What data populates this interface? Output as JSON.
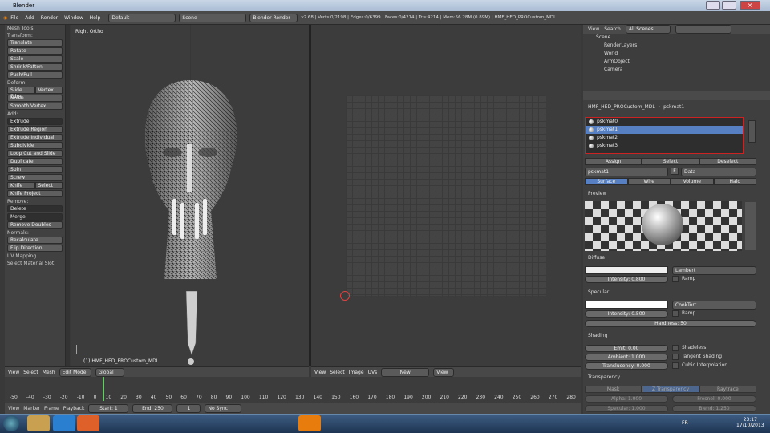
{
  "window": {
    "title": "Blender"
  },
  "topbar": {
    "menus": [
      "File",
      "Add",
      "Render",
      "Window",
      "Help"
    ],
    "layout": "Default",
    "scene": "Scene",
    "engine": "Blender Render",
    "stats": "v2.68 | Verts:0/2198 | Edges:0/6399 | Faces:0/4214 | Tris:4214 | Mem:56.28M (0.89M) | HMF_HED_PROCustom_MDL"
  },
  "toolshelf": {
    "header": "Mesh Tools",
    "transform_label": "Transform:",
    "transform": [
      "Translate",
      "Rotate",
      "Scale",
      "Shrink/Fatten",
      "Push/Pull"
    ],
    "deform_label": "Deform:",
    "slide_edge": "Slide Edge",
    "vertex": "Vertex",
    "deform": [
      "Noise",
      "Smooth Vertex"
    ],
    "add_label": "Add:",
    "extrude": "Extrude",
    "add": [
      "Extrude Region",
      "Extrude Individual",
      "Subdivide",
      "Loop Cut and Slide",
      "Duplicate",
      "Spin",
      "Screw"
    ],
    "knife": "Knife",
    "select": "Select",
    "knife_project": "Knife Project",
    "remove_label": "Remove:",
    "delete": "Delete",
    "merge": "Merge",
    "remove_doubles": "Remove Doubles",
    "normals_label": "Normals:",
    "normals": [
      "Recalculate",
      "Flip Direction"
    ],
    "uv_mapping": "UV Mapping",
    "select_slot": "Select Material Slot"
  },
  "viewport": {
    "view_label": "Right Ortho",
    "object_label": "(1) HMF_HED_PROCustom_MDL"
  },
  "view3d_header": {
    "menus": [
      "View",
      "Select",
      "Mesh"
    ],
    "mode": "Edit Mode",
    "orientation": "Global"
  },
  "image_header": {
    "menus": [
      "View",
      "Select",
      "Image",
      "UVs"
    ],
    "new_btn": "New",
    "view": "View"
  },
  "timeline": {
    "ticks": [
      "-50",
      "-40",
      "-30",
      "-20",
      "-10",
      "0",
      "10",
      "20",
      "30",
      "40",
      "50",
      "60",
      "70",
      "80",
      "90",
      "100",
      "110",
      "120",
      "130",
      "140",
      "150",
      "160",
      "170",
      "180",
      "190",
      "200",
      "210",
      "220",
      "230",
      "240",
      "250",
      "260",
      "270",
      "280"
    ]
  },
  "timeline_header": {
    "menus": [
      "View",
      "Marker",
      "Frame",
      "Playback"
    ],
    "start": "Start: 1",
    "end": "End: 250",
    "current": "1",
    "sync": "No Sync"
  },
  "outliner": {
    "menus": [
      "View",
      "Search"
    ],
    "filter": "All Scenes",
    "items": [
      "Scene",
      "RenderLayers",
      "World",
      "ArmObject",
      "Camera"
    ]
  },
  "properties": {
    "breadcrumb_obj": "HMF_HED_PROCustom_MDL",
    "breadcrumb_mat": "pskmat1",
    "slots": [
      "pskmat0",
      "pskmat1",
      "pskmat2",
      "pskmat3"
    ],
    "assign": "Assign",
    "select": "Select",
    "deselect": "Deselect",
    "material_name": "pskmat1",
    "f": "F",
    "data": "Data",
    "tabs": [
      "Surface",
      "Wire",
      "Volume",
      "Halo"
    ],
    "preview": "Preview",
    "diffuse": "Diffuse",
    "diffuse_shader": "Lambert",
    "intensity_d": "Intensity: 0.800",
    "ramp": "Ramp",
    "specular": "Specular",
    "specular_shader": "CookTorr",
    "intensity_s": "Intensity: 0.500",
    "hardness": "Hardness: 50",
    "shading": "Shading",
    "emit": "Emit: 0.00",
    "ambient": "Ambient: 1.000",
    "translucency": "Translucency: 0.000",
    "shadeless": "Shadeless",
    "tangent": "Tangent Shading",
    "cubic": "Cubic Interpolation",
    "transparency": "Transparency",
    "mask": "Mask",
    "ztrans": "Z Transparency",
    "raytrace": "Raytrace",
    "alpha": "Alpha: 1.000",
    "fresnel": "Fresnel: 0.000",
    "specular_t": "Specular: 1.000",
    "blend": "Blend: 1.250"
  },
  "taskbar": {
    "lang": "FR",
    "time": "23:17",
    "date": "17/10/2013"
  }
}
